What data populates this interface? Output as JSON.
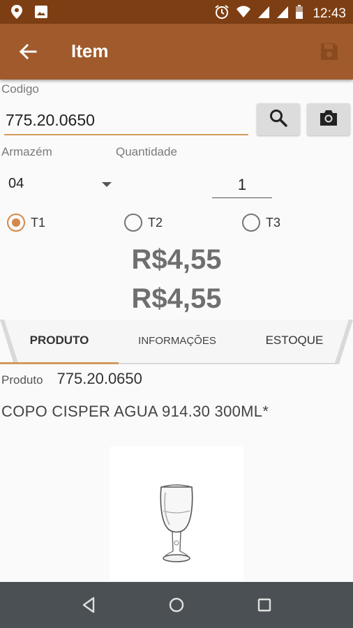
{
  "status_bar": {
    "time": "12:43",
    "icons_left": [
      "location-icon",
      "image-icon"
    ],
    "icons_right": [
      "alarm-icon",
      "wifi-icon",
      "signal-icon",
      "signal-icon-2",
      "battery-icon"
    ]
  },
  "app_bar": {
    "title": "Item",
    "back_icon": "arrow-back-icon",
    "save_icon": "save-icon"
  },
  "form": {
    "codigo_label": "Codigo",
    "codigo_value": "775.20.0650",
    "search_icon": "search-icon",
    "camera_icon": "camera-icon",
    "armazem_label": "Armazém",
    "armazem_value": "04",
    "quantidade_label": "Quantidade",
    "quantidade_value": "1",
    "radios": [
      {
        "label": "T1",
        "checked": true
      },
      {
        "label": "T2",
        "checked": false
      },
      {
        "label": "T3",
        "checked": false
      }
    ],
    "price_1": "R$4,55",
    "price_2": "R$4,55"
  },
  "tabs": [
    {
      "label": "PRODUTO",
      "selected": true
    },
    {
      "label": "INFORMAÇÕES",
      "selected": false
    },
    {
      "label": "ESTOQUE",
      "selected": false
    }
  ],
  "product": {
    "label": "Produto",
    "code": "775.20.0650",
    "description": "COPO CISPER AGUA 914.30 300ML*",
    "image_icon": "wine-glass-image"
  },
  "colors": {
    "status_bar": "#7e3e13",
    "app_bar": "#a05a2c",
    "accent": "#d29a5a",
    "radio_checked": "#d4884a",
    "nav_bar": "#4a5053"
  },
  "nav_bar": {
    "back": "nav-back-icon",
    "home": "nav-home-icon",
    "recents": "nav-recents-icon"
  }
}
